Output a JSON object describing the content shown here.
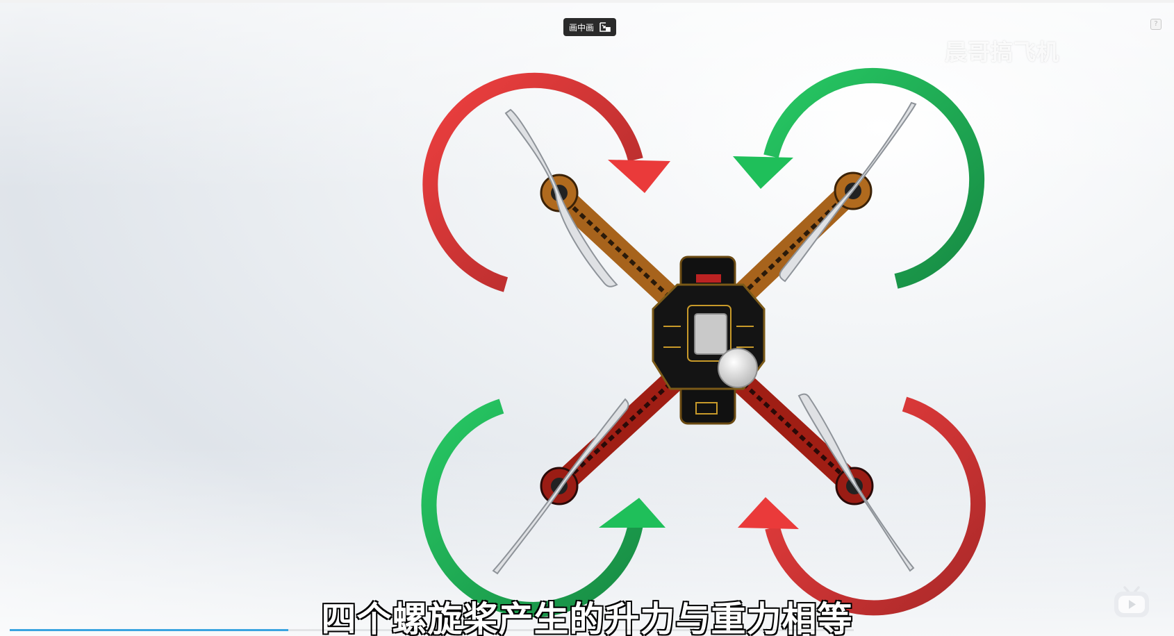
{
  "player": {
    "pip_label": "画中画",
    "help_label": "?",
    "watermark": "晨哥搞飞机",
    "subtitle": "四个螺旋桨产生的升力与重力相等",
    "progress": 0.33
  },
  "icons": {
    "pip": "picture-in-picture-icon",
    "help": "help-icon",
    "logo": "bilibili-logo-icon"
  },
  "colors": {
    "red_arrow": "#e33b3b",
    "green_arrow": "#1fbf5a",
    "progress": "#3aa4e0"
  }
}
